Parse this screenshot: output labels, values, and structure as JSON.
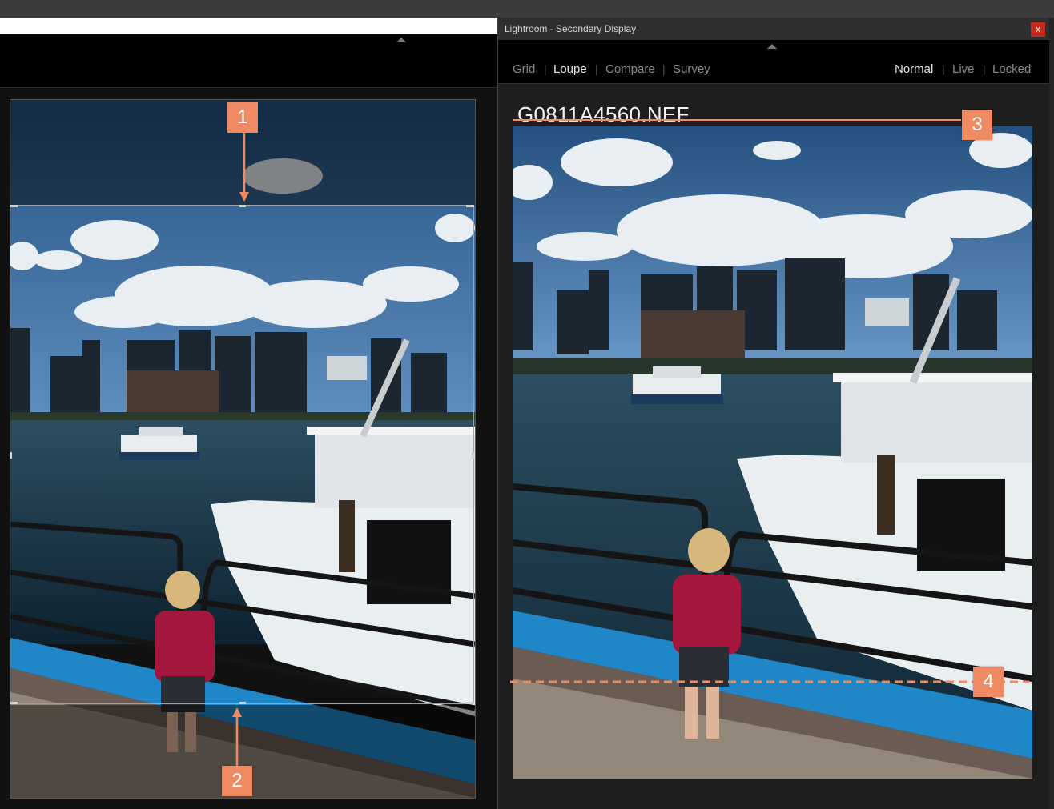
{
  "secondary_window": {
    "title": "Lightroom - Secondary Display",
    "close_label": "x",
    "view_modes": [
      "Grid",
      "Loupe",
      "Compare",
      "Survey"
    ],
    "active_view": "Loupe",
    "display_modes": [
      "Normal",
      "Live",
      "Locked"
    ],
    "active_display": "Normal",
    "filename": "G0811A4560.NEF"
  },
  "callouts": {
    "c1": "1",
    "c2": "2",
    "c3": "3",
    "c4": "4"
  },
  "colors": {
    "callout": "#f08a63",
    "close_button": "#c42b1c",
    "sky": "#2f5f93",
    "water": "#1e3a4a",
    "rail_blue": "#1f87c7"
  },
  "icons": {
    "collapse_arrow": "triangle-up-icon"
  }
}
